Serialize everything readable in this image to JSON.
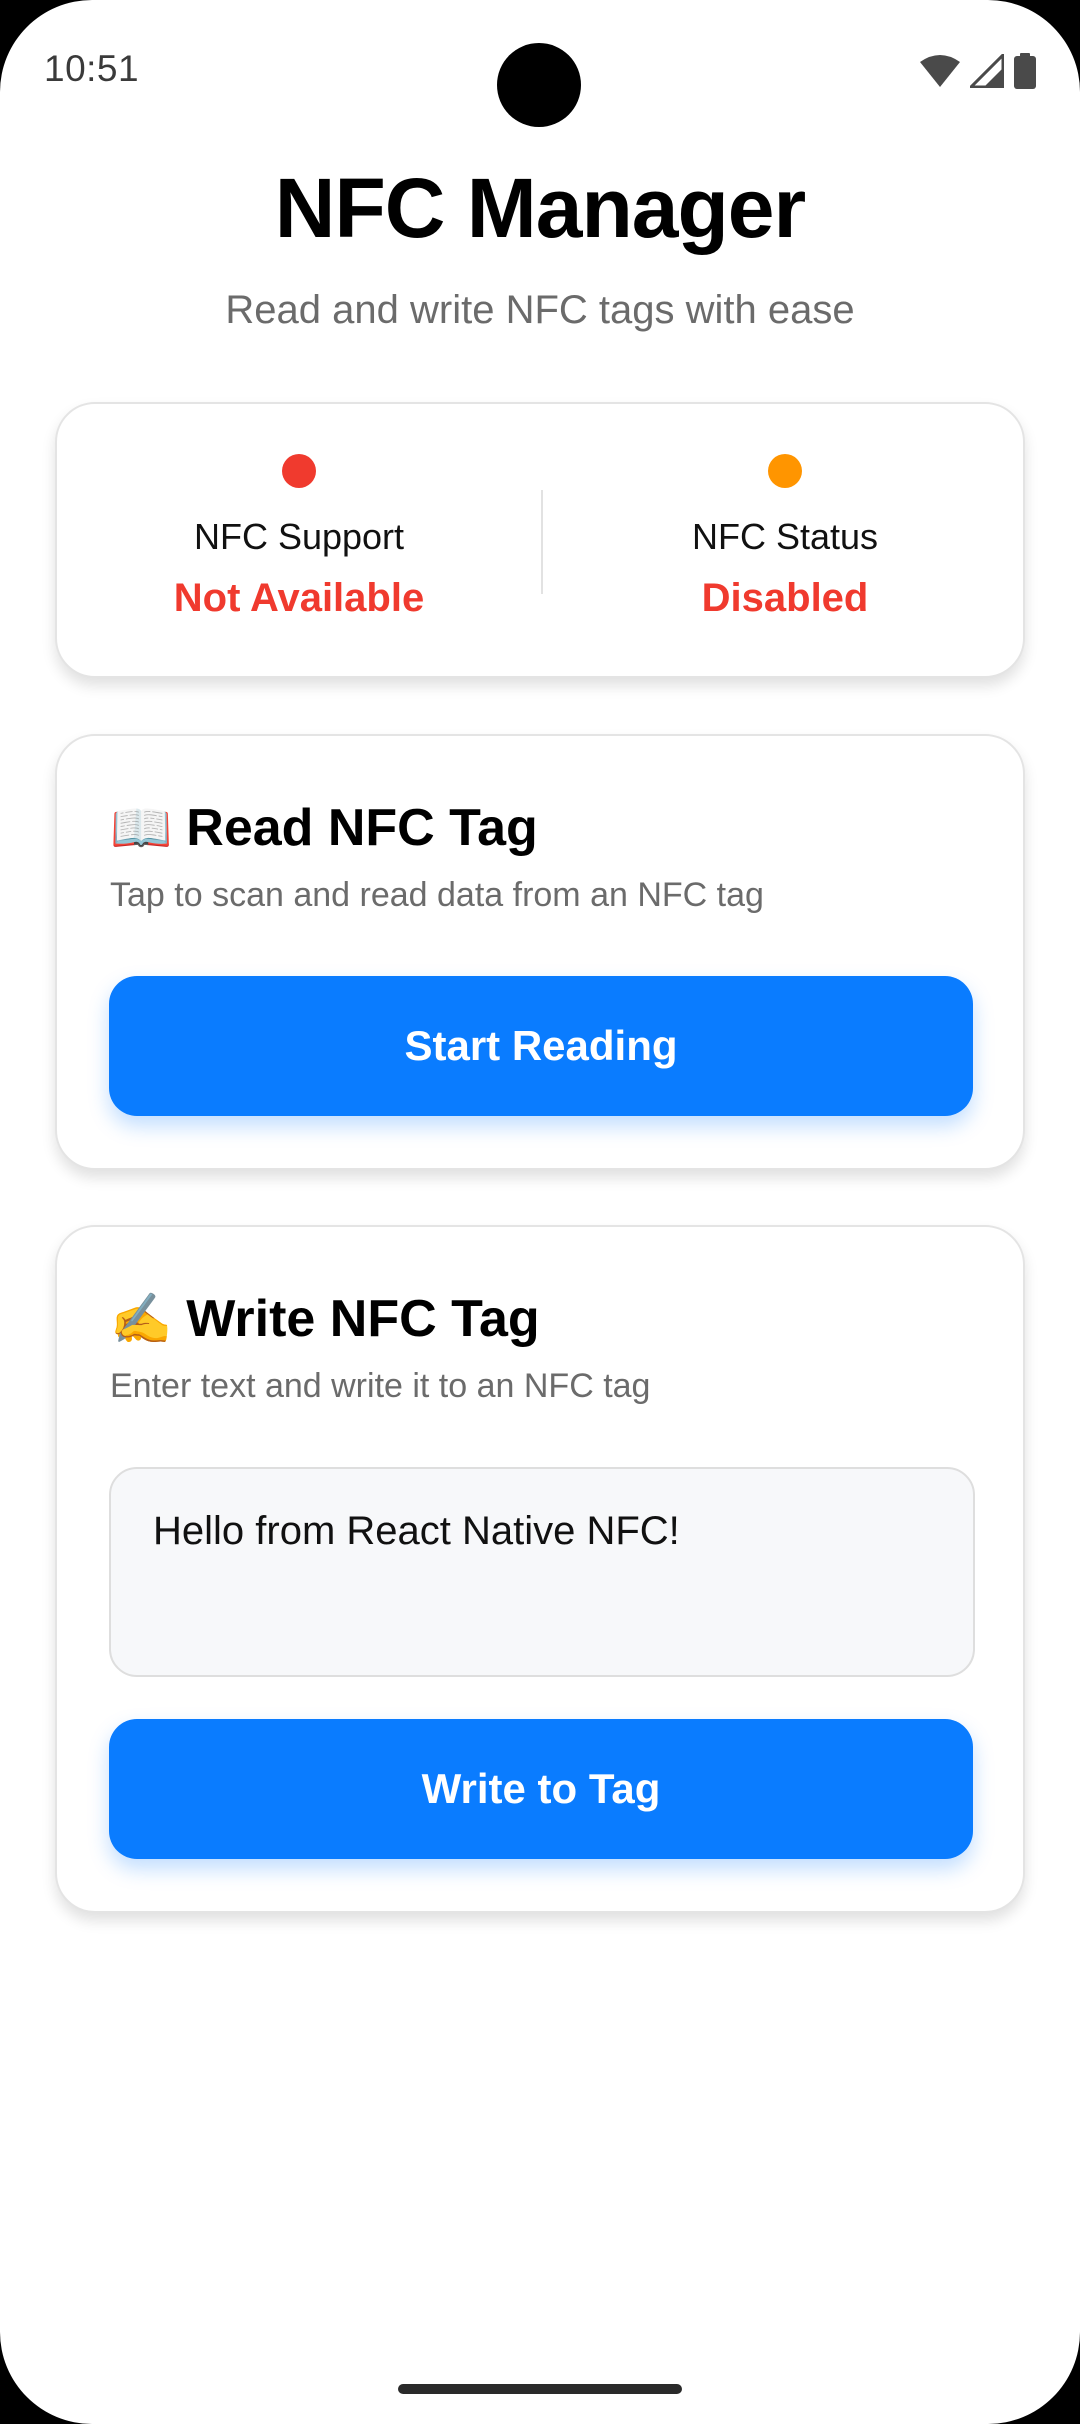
{
  "status_bar": {
    "time": "10:51",
    "icons": [
      "wifi-icon",
      "cell-signal-icon",
      "battery-icon"
    ]
  },
  "header": {
    "title": "NFC Manager",
    "subtitle": "Read and write NFC tags with ease"
  },
  "status_card": {
    "support": {
      "label": "NFC Support",
      "value": "Not Available",
      "dot_color": "#f03a2e",
      "value_color": "#f03a2e"
    },
    "status": {
      "label": "NFC Status",
      "value": "Disabled",
      "dot_color": "#ff9500",
      "value_color": "#f03a2e"
    }
  },
  "read_card": {
    "emoji": "📖",
    "title": "Read NFC Tag",
    "description": "Tap to scan and read data from an NFC tag",
    "button_label": "Start Reading"
  },
  "write_card": {
    "emoji": "✍️",
    "title": "Write NFC Tag",
    "description": "Enter text and write it to an NFC tag",
    "input_value": "Hello from React Native NFC!",
    "button_label": "Write to Tag"
  },
  "colors": {
    "accent": "#0a7cff",
    "error": "#f03a2e",
    "warning": "#ff9500"
  }
}
